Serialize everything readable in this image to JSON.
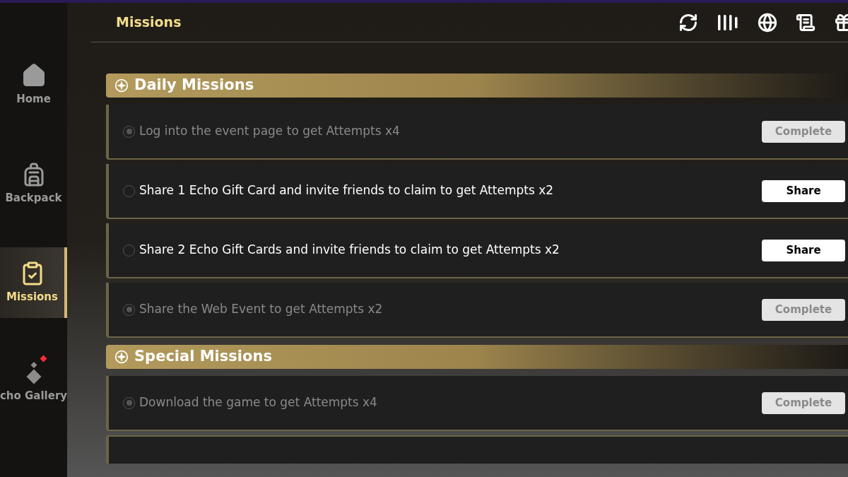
{
  "sidebar": {
    "items": [
      {
        "kind": "home",
        "label": "Home",
        "selected": false,
        "notification": false
      },
      {
        "kind": "backpack",
        "label": "Backpack",
        "selected": false,
        "notification": false
      },
      {
        "kind": "missions",
        "label": "Missions",
        "selected": true,
        "notification": false
      },
      {
        "kind": "gallery",
        "label": "cho Gallery",
        "selected": false,
        "notification": true
      }
    ]
  },
  "header": {
    "title": "Missions"
  },
  "sections": [
    {
      "title": "Daily Missions",
      "missions": [
        {
          "text": "Log into the event page to get Attempts x4",
          "done": true,
          "button": "Complete"
        },
        {
          "text": "Share 1 Echo Gift Card and invite friends to claim to get Attempts x2",
          "done": false,
          "button": "Share"
        },
        {
          "text": "Share 2 Echo Gift Cards and invite friends to claim to get Attempts x2",
          "done": false,
          "button": "Share"
        },
        {
          "text": "Share the Web Event to get Attempts x2",
          "done": true,
          "button": "Complete"
        }
      ]
    },
    {
      "title": "Special Missions",
      "missions": [
        {
          "text": "Download the game to get Attempts x4",
          "done": true,
          "button": "Complete"
        }
      ]
    }
  ]
}
